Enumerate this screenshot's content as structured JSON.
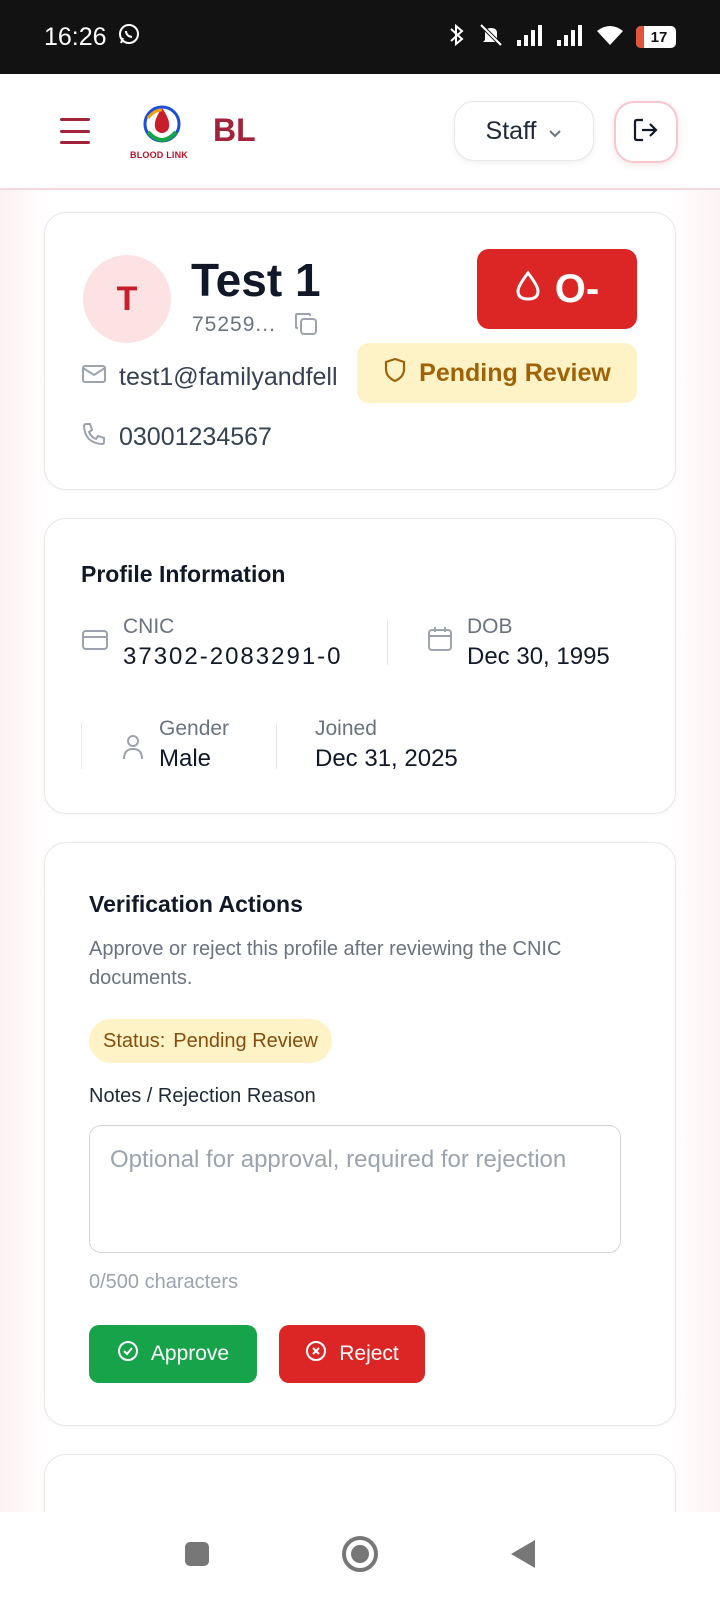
{
  "status_bar": {
    "time": "16:26",
    "battery": "17"
  },
  "header": {
    "brand": "BL",
    "logo_text": "BLOOD LINK",
    "role": "Staff"
  },
  "donor": {
    "avatar_initial": "T",
    "name": "Test 1",
    "id_short": "75259...",
    "blood_group": "O-",
    "status": "Pending Review",
    "email": "test1@familyandfell",
    "phone": "03001234567"
  },
  "profile": {
    "title": "Profile Information",
    "cnic_label": "CNIC",
    "cnic_value": "37302-2083291-0",
    "dob_label": "DOB",
    "dob_value": "Dec 30, 1995",
    "gender_label": "Gender",
    "gender_value": "Male",
    "joined_label": "Joined",
    "joined_value": "Dec 31, 2025"
  },
  "verification": {
    "title": "Verification Actions",
    "description": "Approve or reject this profile after reviewing the CNIC documents.",
    "status_prefix": "Status:",
    "status_value": "Pending Review",
    "notes_label": "Notes / Rejection Reason",
    "notes_value": "",
    "notes_placeholder": "Optional for approval, required for rejection",
    "char_count": "0/500 characters",
    "approve_label": "Approve",
    "reject_label": "Reject"
  },
  "colors": {
    "brand": "#a3233a",
    "blood_badge": "#dc2626",
    "approve": "#16a34a",
    "reject": "#dc2626",
    "pending_bg": "#fef3c7",
    "pending_text": "#a16207"
  }
}
